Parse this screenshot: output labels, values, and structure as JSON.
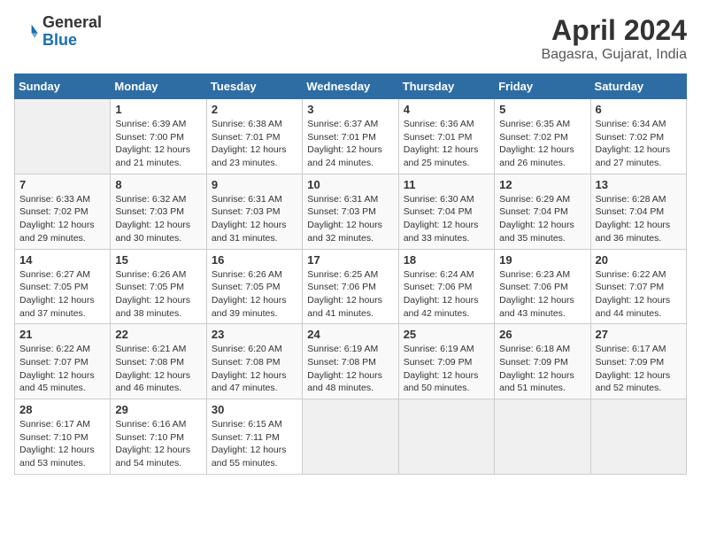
{
  "header": {
    "logo_line1": "General",
    "logo_line2": "Blue",
    "title": "April 2024",
    "subtitle": "Bagasra, Gujarat, India"
  },
  "weekdays": [
    "Sunday",
    "Monday",
    "Tuesday",
    "Wednesday",
    "Thursday",
    "Friday",
    "Saturday"
  ],
  "weeks": [
    [
      {
        "day": "",
        "sunrise": "",
        "sunset": "",
        "daylight": ""
      },
      {
        "day": "1",
        "sunrise": "Sunrise: 6:39 AM",
        "sunset": "Sunset: 7:00 PM",
        "daylight": "Daylight: 12 hours and 21 minutes."
      },
      {
        "day": "2",
        "sunrise": "Sunrise: 6:38 AM",
        "sunset": "Sunset: 7:01 PM",
        "daylight": "Daylight: 12 hours and 23 minutes."
      },
      {
        "day": "3",
        "sunrise": "Sunrise: 6:37 AM",
        "sunset": "Sunset: 7:01 PM",
        "daylight": "Daylight: 12 hours and 24 minutes."
      },
      {
        "day": "4",
        "sunrise": "Sunrise: 6:36 AM",
        "sunset": "Sunset: 7:01 PM",
        "daylight": "Daylight: 12 hours and 25 minutes."
      },
      {
        "day": "5",
        "sunrise": "Sunrise: 6:35 AM",
        "sunset": "Sunset: 7:02 PM",
        "daylight": "Daylight: 12 hours and 26 minutes."
      },
      {
        "day": "6",
        "sunrise": "Sunrise: 6:34 AM",
        "sunset": "Sunset: 7:02 PM",
        "daylight": "Daylight: 12 hours and 27 minutes."
      }
    ],
    [
      {
        "day": "7",
        "sunrise": "Sunrise: 6:33 AM",
        "sunset": "Sunset: 7:02 PM",
        "daylight": "Daylight: 12 hours and 29 minutes."
      },
      {
        "day": "8",
        "sunrise": "Sunrise: 6:32 AM",
        "sunset": "Sunset: 7:03 PM",
        "daylight": "Daylight: 12 hours and 30 minutes."
      },
      {
        "day": "9",
        "sunrise": "Sunrise: 6:31 AM",
        "sunset": "Sunset: 7:03 PM",
        "daylight": "Daylight: 12 hours and 31 minutes."
      },
      {
        "day": "10",
        "sunrise": "Sunrise: 6:31 AM",
        "sunset": "Sunset: 7:03 PM",
        "daylight": "Daylight: 12 hours and 32 minutes."
      },
      {
        "day": "11",
        "sunrise": "Sunrise: 6:30 AM",
        "sunset": "Sunset: 7:04 PM",
        "daylight": "Daylight: 12 hours and 33 minutes."
      },
      {
        "day": "12",
        "sunrise": "Sunrise: 6:29 AM",
        "sunset": "Sunset: 7:04 PM",
        "daylight": "Daylight: 12 hours and 35 minutes."
      },
      {
        "day": "13",
        "sunrise": "Sunrise: 6:28 AM",
        "sunset": "Sunset: 7:04 PM",
        "daylight": "Daylight: 12 hours and 36 minutes."
      }
    ],
    [
      {
        "day": "14",
        "sunrise": "Sunrise: 6:27 AM",
        "sunset": "Sunset: 7:05 PM",
        "daylight": "Daylight: 12 hours and 37 minutes."
      },
      {
        "day": "15",
        "sunrise": "Sunrise: 6:26 AM",
        "sunset": "Sunset: 7:05 PM",
        "daylight": "Daylight: 12 hours and 38 minutes."
      },
      {
        "day": "16",
        "sunrise": "Sunrise: 6:26 AM",
        "sunset": "Sunset: 7:05 PM",
        "daylight": "Daylight: 12 hours and 39 minutes."
      },
      {
        "day": "17",
        "sunrise": "Sunrise: 6:25 AM",
        "sunset": "Sunset: 7:06 PM",
        "daylight": "Daylight: 12 hours and 41 minutes."
      },
      {
        "day": "18",
        "sunrise": "Sunrise: 6:24 AM",
        "sunset": "Sunset: 7:06 PM",
        "daylight": "Daylight: 12 hours and 42 minutes."
      },
      {
        "day": "19",
        "sunrise": "Sunrise: 6:23 AM",
        "sunset": "Sunset: 7:06 PM",
        "daylight": "Daylight: 12 hours and 43 minutes."
      },
      {
        "day": "20",
        "sunrise": "Sunrise: 6:22 AM",
        "sunset": "Sunset: 7:07 PM",
        "daylight": "Daylight: 12 hours and 44 minutes."
      }
    ],
    [
      {
        "day": "21",
        "sunrise": "Sunrise: 6:22 AM",
        "sunset": "Sunset: 7:07 PM",
        "daylight": "Daylight: 12 hours and 45 minutes."
      },
      {
        "day": "22",
        "sunrise": "Sunrise: 6:21 AM",
        "sunset": "Sunset: 7:08 PM",
        "daylight": "Daylight: 12 hours and 46 minutes."
      },
      {
        "day": "23",
        "sunrise": "Sunrise: 6:20 AM",
        "sunset": "Sunset: 7:08 PM",
        "daylight": "Daylight: 12 hours and 47 minutes."
      },
      {
        "day": "24",
        "sunrise": "Sunrise: 6:19 AM",
        "sunset": "Sunset: 7:08 PM",
        "daylight": "Daylight: 12 hours and 48 minutes."
      },
      {
        "day": "25",
        "sunrise": "Sunrise: 6:19 AM",
        "sunset": "Sunset: 7:09 PM",
        "daylight": "Daylight: 12 hours and 50 minutes."
      },
      {
        "day": "26",
        "sunrise": "Sunrise: 6:18 AM",
        "sunset": "Sunset: 7:09 PM",
        "daylight": "Daylight: 12 hours and 51 minutes."
      },
      {
        "day": "27",
        "sunrise": "Sunrise: 6:17 AM",
        "sunset": "Sunset: 7:09 PM",
        "daylight": "Daylight: 12 hours and 52 minutes."
      }
    ],
    [
      {
        "day": "28",
        "sunrise": "Sunrise: 6:17 AM",
        "sunset": "Sunset: 7:10 PM",
        "daylight": "Daylight: 12 hours and 53 minutes."
      },
      {
        "day": "29",
        "sunrise": "Sunrise: 6:16 AM",
        "sunset": "Sunset: 7:10 PM",
        "daylight": "Daylight: 12 hours and 54 minutes."
      },
      {
        "day": "30",
        "sunrise": "Sunrise: 6:15 AM",
        "sunset": "Sunset: 7:11 PM",
        "daylight": "Daylight: 12 hours and 55 minutes."
      },
      {
        "day": "",
        "sunrise": "",
        "sunset": "",
        "daylight": ""
      },
      {
        "day": "",
        "sunrise": "",
        "sunset": "",
        "daylight": ""
      },
      {
        "day": "",
        "sunrise": "",
        "sunset": "",
        "daylight": ""
      },
      {
        "day": "",
        "sunrise": "",
        "sunset": "",
        "daylight": ""
      }
    ]
  ]
}
